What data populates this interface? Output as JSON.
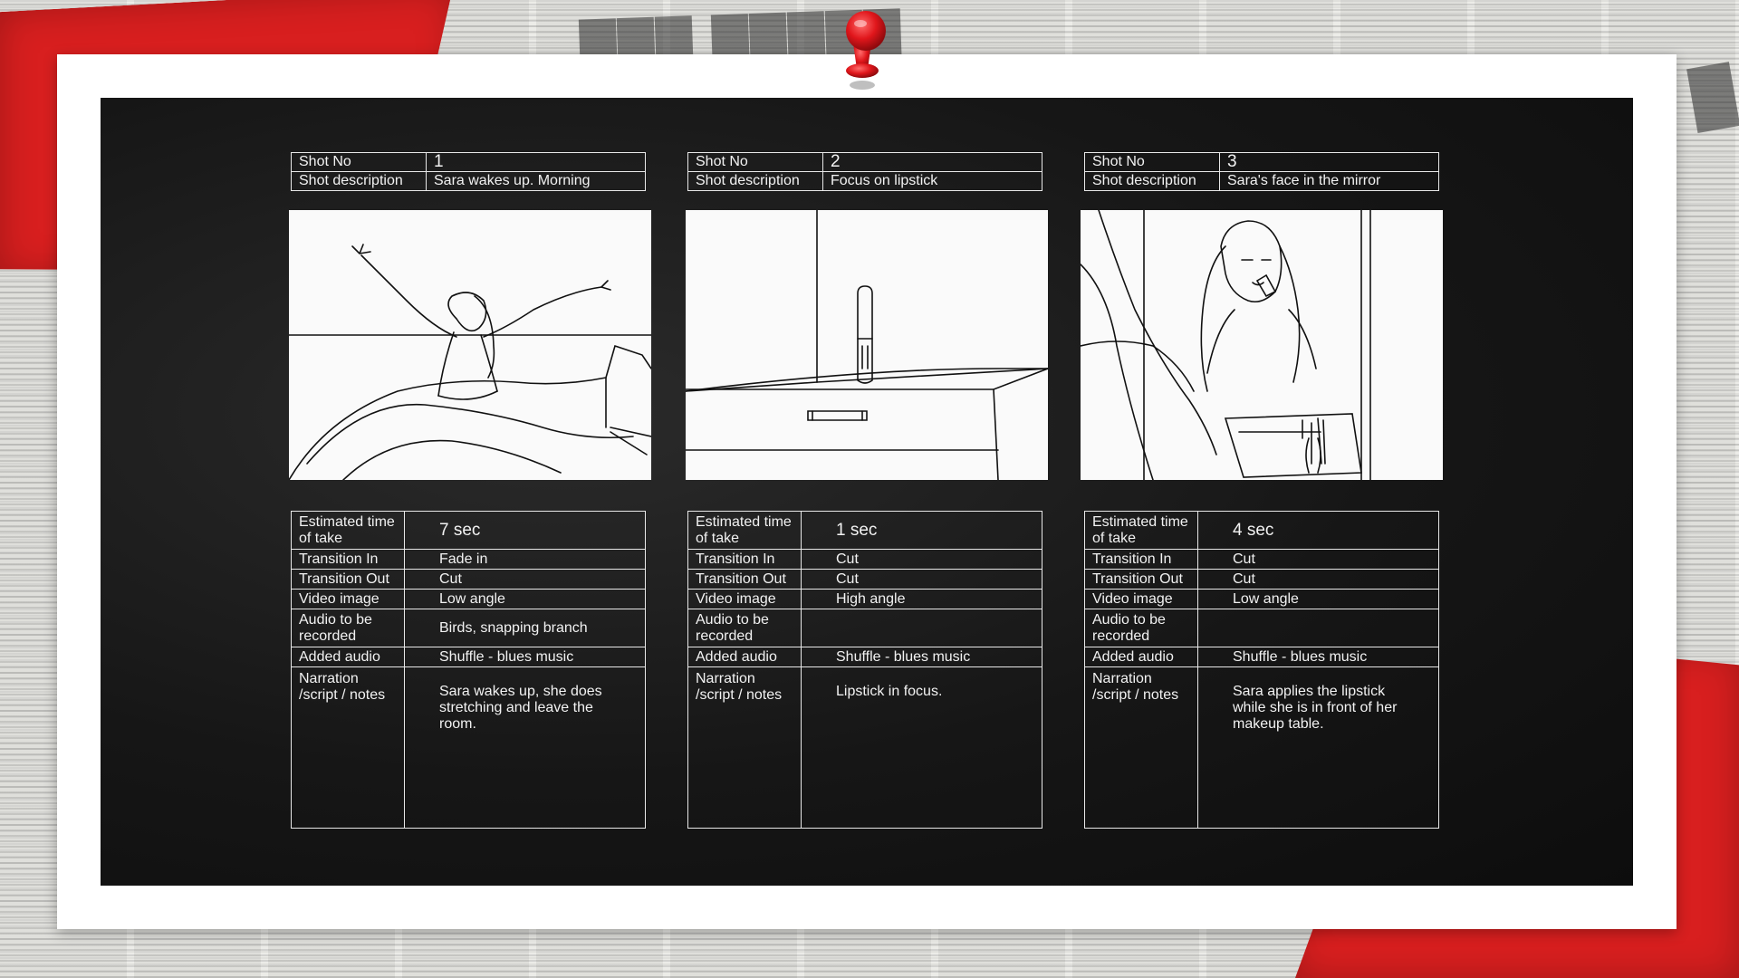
{
  "common_labels": {
    "shot_no": "Shot No",
    "shot_description": "Shot description",
    "estimated_time": "Estimated time of take",
    "transition_in": "Transition In",
    "transition_out": "Transition Out",
    "video_image": "Video image",
    "audio_recorded": "Audio to be recorded",
    "added_audio": "Added audio",
    "narration": "Narration /script / notes"
  },
  "shots": [
    {
      "number": "1",
      "description": "Sara wakes up. Morning",
      "time": "7 sec",
      "transition_in": "Fade in",
      "transition_out": "Cut",
      "video_image": "Low angle",
      "audio_recorded": "Birds, snapping branch",
      "added_audio": "Shuffle - blues music",
      "narration": "Sara wakes up, she does stretching and leave the room."
    },
    {
      "number": "2",
      "description": "Focus on lipstick",
      "time": "1 sec",
      "transition_in": "Cut",
      "transition_out": "Cut",
      "video_image": "High angle",
      "audio_recorded": "",
      "added_audio": "Shuffle - blues music",
      "narration": "Lipstick in focus."
    },
    {
      "number": "3",
      "description": "Sara's face in the mirror",
      "time": "4 sec",
      "transition_in": "Cut",
      "transition_out": "Cut",
      "video_image": "Low angle",
      "audio_recorded": "",
      "added_audio": "Shuffle - blues music",
      "narration": "Sara applies the lipstick while she is in front of her makeup table."
    }
  ],
  "colors": {
    "board": "#161616",
    "frame": "#ffffff",
    "accent_red": "#d81f1f",
    "pin": "#e0161b"
  },
  "icons": {
    "pin": "push-pin-icon"
  }
}
